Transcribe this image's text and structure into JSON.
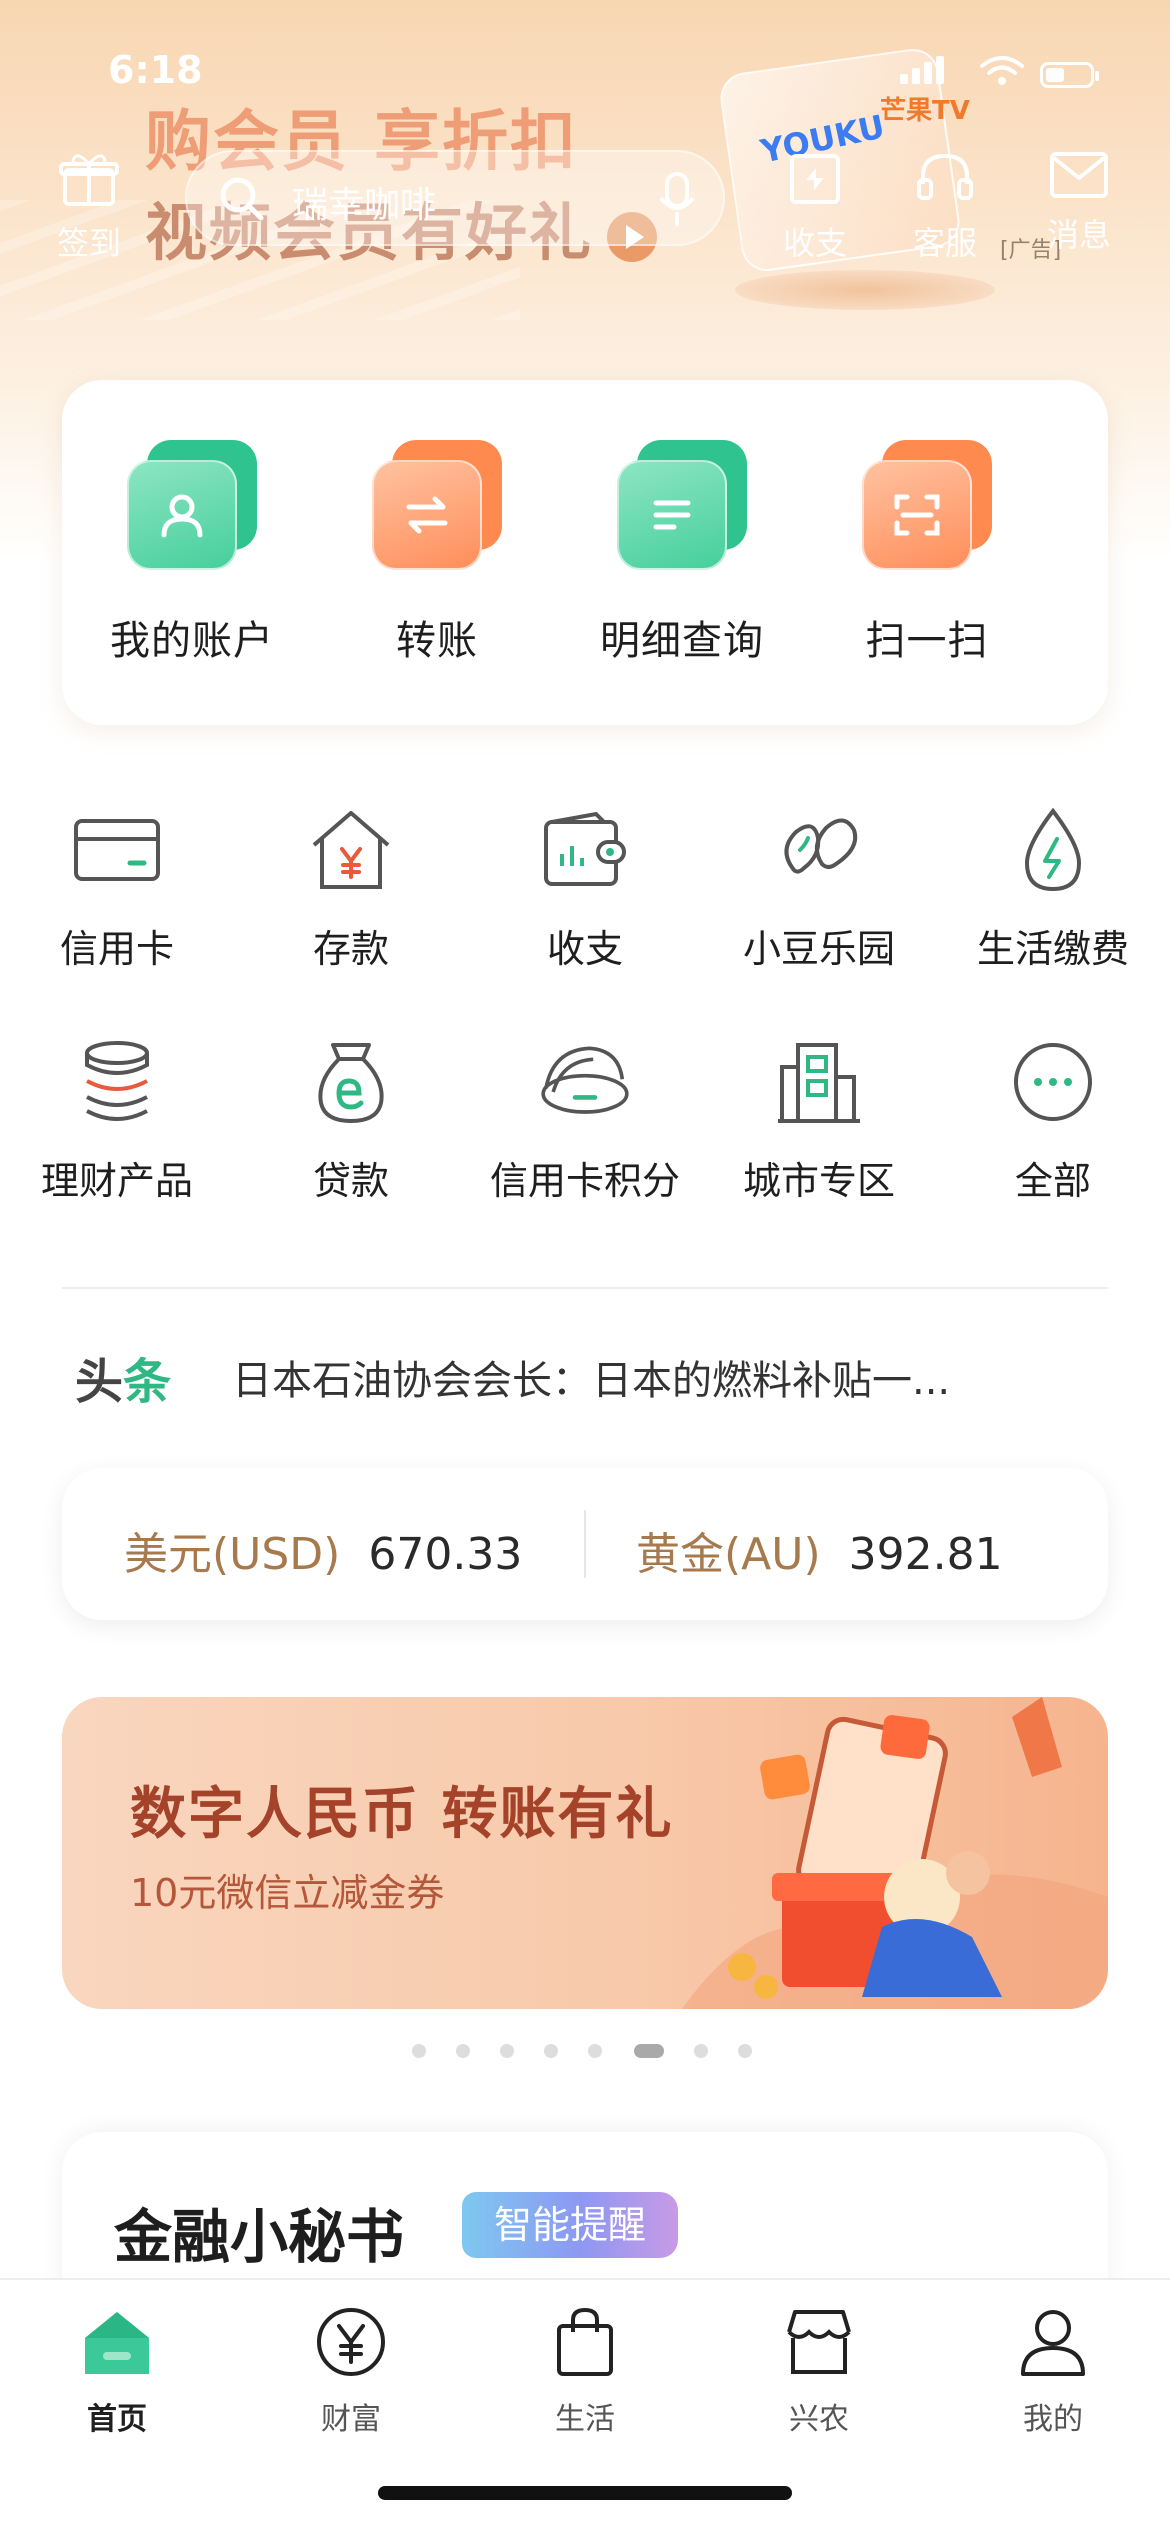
{
  "status_bar": {
    "time": "6:18"
  },
  "header": {
    "checkin_label": "签到",
    "search_placeholder": "瑞幸咖啡",
    "scan_label": "收支",
    "service_label": "客服",
    "message_label": "消息"
  },
  "ad_banner": {
    "line1": "购会员 享折扣",
    "line2": "视频会员有好礼",
    "brand1": "YOUKU",
    "brand2": "芒果TV",
    "tag": "广告"
  },
  "quick_actions": [
    {
      "label": "我的账户",
      "icon": "user-icon",
      "color": "green"
    },
    {
      "label": "转账",
      "icon": "transfer-icon",
      "color": "orange"
    },
    {
      "label": "明细查询",
      "icon": "details-icon",
      "color": "green"
    },
    {
      "label": "扫一扫",
      "icon": "scan-icon",
      "color": "orange"
    }
  ],
  "services": [
    {
      "label": "信用卡",
      "icon": "credit-card-icon"
    },
    {
      "label": "存款",
      "icon": "deposit-house-icon"
    },
    {
      "label": "收支",
      "icon": "wallet-icon"
    },
    {
      "label": "小豆乐园",
      "icon": "beans-icon"
    },
    {
      "label": "生活缴费",
      "icon": "utility-drop-icon"
    },
    {
      "label": "理财产品",
      "icon": "coins-stack-icon"
    },
    {
      "label": "贷款",
      "icon": "loan-bag-icon"
    },
    {
      "label": "信用卡积分",
      "icon": "card-points-icon"
    },
    {
      "label": "城市专区",
      "icon": "city-building-icon"
    },
    {
      "label": "全部",
      "icon": "more-icon"
    }
  ],
  "headline": {
    "tag_part1": "头",
    "tag_part2": "条",
    "text": "日本石油协会会长：日本的燃料补贴一..."
  },
  "rates": [
    {
      "name": "美元(USD)",
      "value": "670.33"
    },
    {
      "name": "黄金(AU)",
      "value": "392.81"
    }
  ],
  "promo_banner": {
    "title": "数字人民币 转账有礼",
    "subtitle": "10元微信立减金券"
  },
  "carousel": {
    "count": 8,
    "active_index": 5
  },
  "secretary": {
    "title": "金融小秘书",
    "badge": "智能提醒"
  },
  "tabs": [
    {
      "label": "首页",
      "icon": "home-icon",
      "active": true
    },
    {
      "label": "财富",
      "icon": "yuan-icon",
      "active": false
    },
    {
      "label": "生活",
      "icon": "shopping-bag-icon",
      "active": false
    },
    {
      "label": "兴农",
      "icon": "store-icon",
      "active": false
    },
    {
      "label": "我的",
      "icon": "profile-icon",
      "active": false
    }
  ],
  "colors": {
    "brand_green": "#2fb883",
    "accent_orange": "#ff8e5a",
    "rate_name": "#a77a4e"
  }
}
